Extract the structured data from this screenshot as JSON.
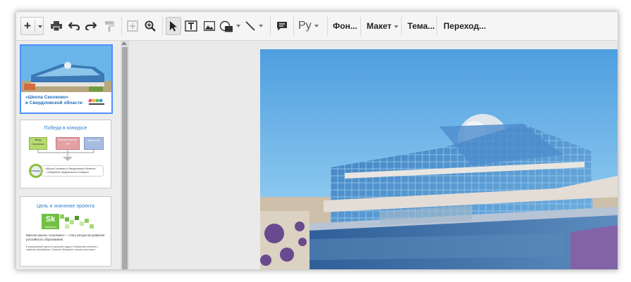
{
  "toolbar": {
    "add_icon": "plus-icon",
    "text_buttons": [
      {
        "id": "background",
        "label": "Фон..."
      },
      {
        "id": "layout",
        "label": "Макет"
      },
      {
        "id": "theme",
        "label": "Тема..."
      },
      {
        "id": "transition",
        "label": "Переход..."
      }
    ],
    "lang_label": "Ру"
  },
  "slides": [
    {
      "line1": "«Школа Сколково»",
      "line2": "в Свердловской области"
    },
    {
      "title": "Победа в конкурсе",
      "boxes": [
        "Вход Сколково",
        "Министерство РФ",
        "Microsoft"
      ],
      "circle_label": "Конкурс",
      "note_line1": "«Школа Сколково в Свердловской области»",
      "note_line2": "– победитель федерального конкурса"
    },
    {
      "title": "Цель и значение проекта",
      "logo_text": "Sk",
      "logo_sub": "Skolkovo",
      "bullet1": "Миссия школы «Сколково» – стать ресурсом развития российского образования.",
      "bullet2": "В инициативной группе по решению задачи «Повышение качества и развития образования» Сколково объединяет лучших участников."
    }
  ],
  "colors": {
    "accent": "#4d90fe",
    "sky": "#5aa8e3",
    "glass": "#3d7fb8"
  }
}
